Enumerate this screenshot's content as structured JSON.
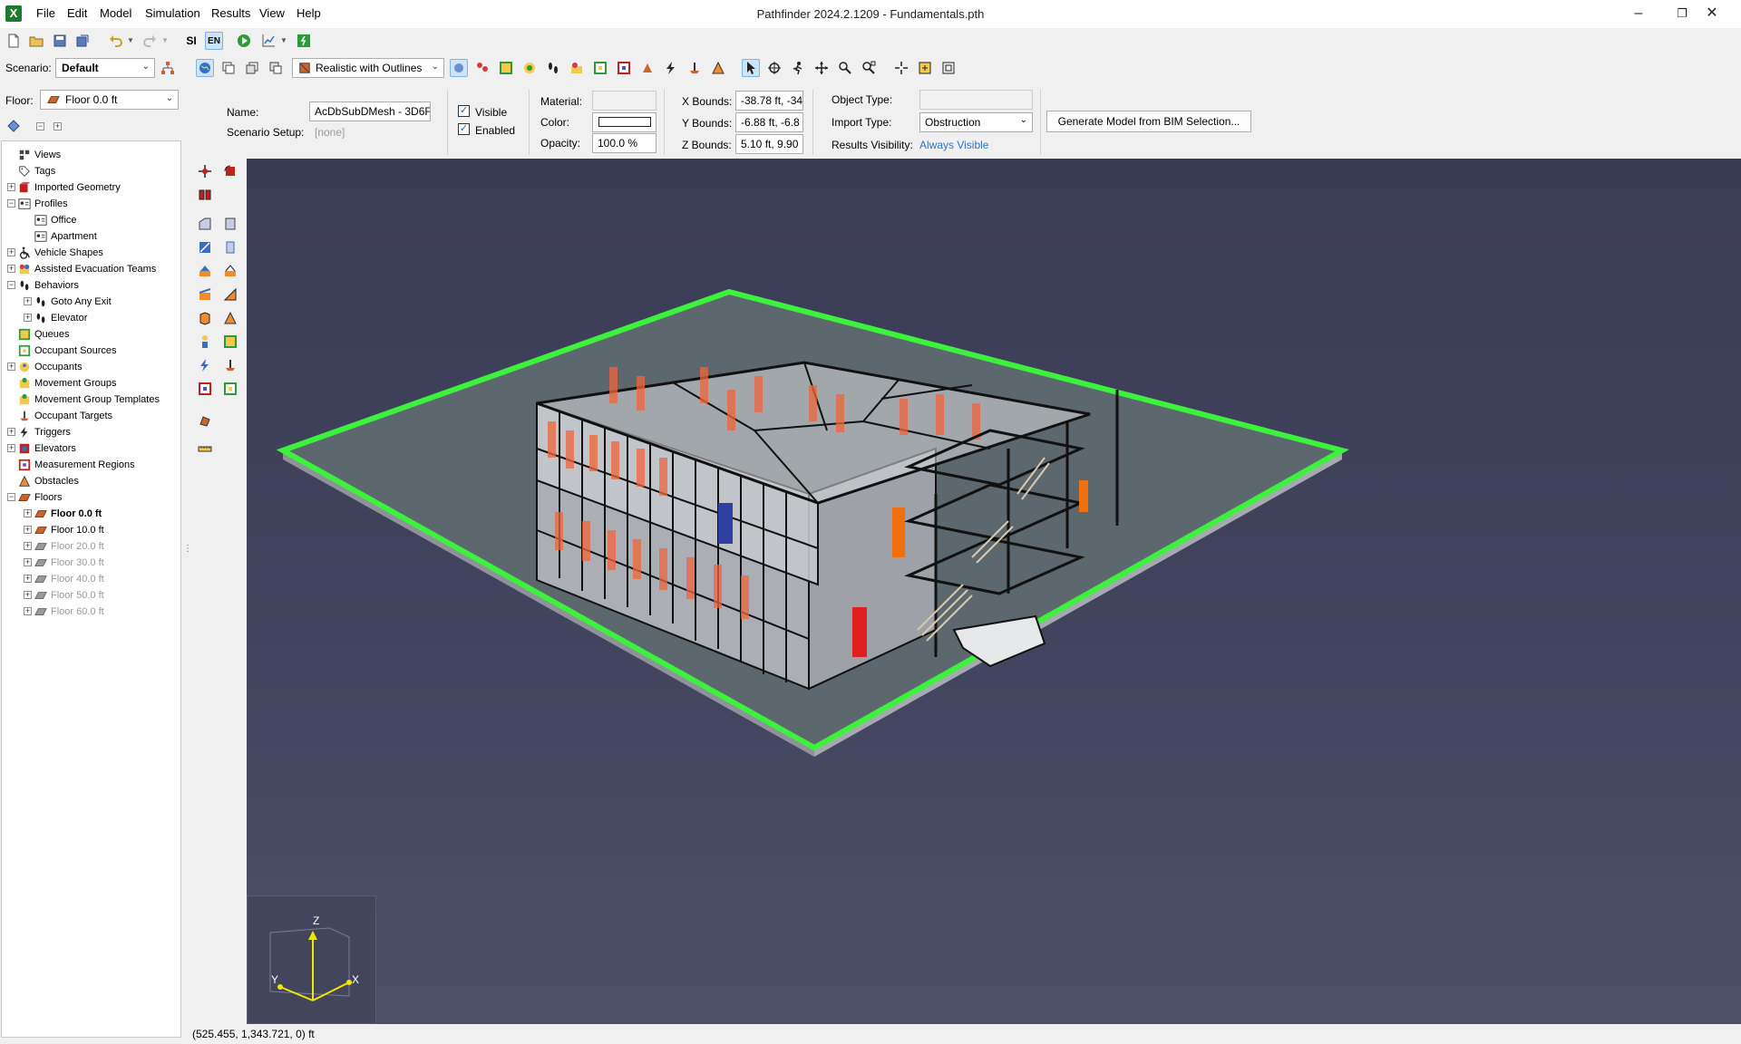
{
  "app": {
    "window_title": "Pathfinder 2024.2.1209 - Fundamentals.pth",
    "icon_letter": "X"
  },
  "menu": [
    "File",
    "Edit",
    "Model",
    "Simulation",
    "Results",
    "View",
    "Help"
  ],
  "toolbar": {
    "si_label": "SI",
    "en_label": "EN",
    "scenario_label": "Scenario:",
    "scenario_value": "Default",
    "render_mode": "Realistic with Outlines"
  },
  "floor_selector": {
    "label": "Floor:",
    "value": "Floor 0.0 ft"
  },
  "properties": {
    "name_label": "Name:",
    "name_value": "AcDbSubDMesh - 3D6F",
    "scenario_setup_label": "Scenario Setup:",
    "scenario_setup_value": "[none]",
    "visible_label": "Visible",
    "enabled_label": "Enabled",
    "material_label": "Material:",
    "color_label": "Color:",
    "opacity_label": "Opacity:",
    "opacity_value": "100.0 %",
    "x_bounds_label": "X Bounds:",
    "x_bounds_value": "-38.78 ft, -34",
    "y_bounds_label": "Y Bounds:",
    "y_bounds_value": "-6.88 ft, -6.8",
    "z_bounds_label": "Z Bounds:",
    "z_bounds_value": "5.10 ft, 9.90",
    "object_type_label": "Object Type:",
    "import_type_label": "Import Type:",
    "import_type_value": "Obstruction",
    "results_visibility_label": "Results Visibility:",
    "results_visibility_value": "Always Visible",
    "generate_button": "Generate Model from BIM Selection..."
  },
  "tree": [
    {
      "label": "Views",
      "icon": "views-icon",
      "expander": "",
      "indent": 0
    },
    {
      "label": "Tags",
      "icon": "tag-icon",
      "expander": "",
      "indent": 0
    },
    {
      "label": "Imported Geometry",
      "icon": "geometry-icon",
      "expander": "+",
      "indent": 0
    },
    {
      "label": "Profiles",
      "icon": "profile-icon",
      "expander": "-",
      "indent": 0
    },
    {
      "label": "Office",
      "icon": "profile-icon",
      "expander": "",
      "indent": 1
    },
    {
      "label": "Apartment",
      "icon": "profile-icon",
      "expander": "",
      "indent": 1
    },
    {
      "label": "Vehicle Shapes",
      "icon": "wheelchair-icon",
      "expander": "+",
      "indent": 0
    },
    {
      "label": "Assisted Evacuation Teams",
      "icon": "team-icon",
      "expander": "+",
      "indent": 0
    },
    {
      "label": "Behaviors",
      "icon": "footprints-icon",
      "expander": "-",
      "indent": 0
    },
    {
      "label": "Goto Any Exit",
      "icon": "footprints-icon",
      "expander": "+",
      "indent": 1
    },
    {
      "label": "Elevator",
      "icon": "footprints-icon",
      "expander": "+",
      "indent": 1
    },
    {
      "label": "Queues",
      "icon": "queue-icon",
      "expander": "",
      "indent": 0
    },
    {
      "label": "Occupant Sources",
      "icon": "source-icon",
      "expander": "",
      "indent": 0
    },
    {
      "label": "Occupants",
      "icon": "occupants-icon",
      "expander": "+",
      "indent": 0
    },
    {
      "label": "Movement Groups",
      "icon": "group-icon",
      "expander": "",
      "indent": 0
    },
    {
      "label": "Movement Group Templates",
      "icon": "group-icon",
      "expander": "",
      "indent": 0
    },
    {
      "label": "Occupant Targets",
      "icon": "target-icon",
      "expander": "",
      "indent": 0
    },
    {
      "label": "Triggers",
      "icon": "trigger-icon",
      "expander": "+",
      "indent": 0
    },
    {
      "label": "Elevators",
      "icon": "elevator-icon",
      "expander": "+",
      "indent": 0
    },
    {
      "label": "Measurement Regions",
      "icon": "measure-icon",
      "expander": "",
      "indent": 0
    },
    {
      "label": "Obstacles",
      "icon": "obstacle-icon",
      "expander": "",
      "indent": 0
    },
    {
      "label": "Floors",
      "icon": "floor-icon",
      "expander": "-",
      "indent": 0
    },
    {
      "label": "Floor 0.0 ft",
      "icon": "floor-icon",
      "expander": "+",
      "indent": 1,
      "style": "bold"
    },
    {
      "label": "Floor 10.0 ft",
      "icon": "floor-icon",
      "expander": "+",
      "indent": 1,
      "style": ""
    },
    {
      "label": "Floor 20.0 ft",
      "icon": "floor-gray-icon",
      "expander": "+",
      "indent": 1,
      "style": "gray"
    },
    {
      "label": "Floor 30.0 ft",
      "icon": "floor-gray-icon",
      "expander": "+",
      "indent": 1,
      "style": "gray"
    },
    {
      "label": "Floor 40.0 ft",
      "icon": "floor-gray-icon",
      "expander": "+",
      "indent": 1,
      "style": "gray"
    },
    {
      "label": "Floor 50.0 ft",
      "icon": "floor-gray-icon",
      "expander": "+",
      "indent": 1,
      "style": "gray"
    },
    {
      "label": "Floor 60.0 ft",
      "icon": "floor-gray-icon",
      "expander": "+",
      "indent": 1,
      "style": "gray"
    }
  ],
  "axes": {
    "z": "Z",
    "y": "Y",
    "x": "X"
  },
  "status": {
    "coordinates": "(525.455, 1,343.721, 0) ft"
  },
  "colors": {
    "floor_outline": "#3cf23c",
    "viewport_bg": "#3e4058",
    "accent_link": "#2d74c9",
    "occupant_orange": "#f0643c"
  }
}
